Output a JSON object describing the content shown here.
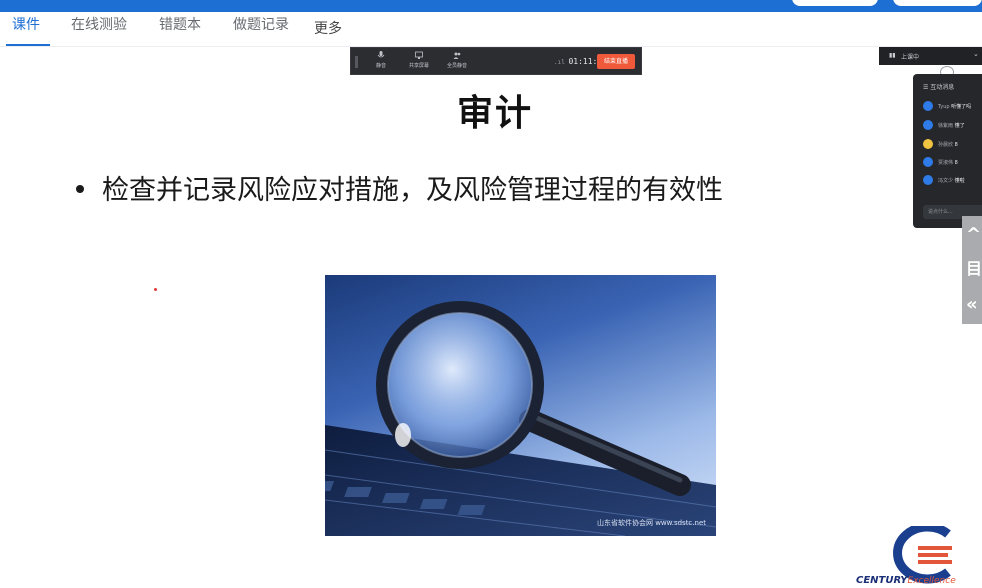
{
  "tabs": [
    {
      "label": "课件",
      "active": true
    },
    {
      "label": "在线测验",
      "active": false
    },
    {
      "label": "错题本",
      "active": false
    },
    {
      "label": "做题记录",
      "active": false
    },
    {
      "label": "更多",
      "active": false
    }
  ],
  "meeting_bar": {
    "mute_label": "静音",
    "share_label": "共享屏幕",
    "members_label": "全员静音",
    "timer": "01:11:32",
    "end_label": "结束直播"
  },
  "slide": {
    "title": "审计",
    "bullet": "检查并记录风险应对措施，及风险管理过程的有效性",
    "image_watermark": "山东省软件协会网 www.sdstc.net"
  },
  "panel": {
    "status": "上课中",
    "header": "互动消息",
    "messages": [
      {
        "name": "Tyup",
        "text": "听懂了吗"
      },
      {
        "name": "徐紫雨",
        "text": "懂了"
      },
      {
        "name": "孙晨欣",
        "text": "8"
      },
      {
        "name": "贾淑伟",
        "text": "8"
      },
      {
        "name": "冯文少",
        "text": "懂啦"
      }
    ],
    "input_placeholder": "说点什么..."
  },
  "logo": {
    "brand": "CENTURY",
    "tagline": "Excellence"
  },
  "colors": {
    "accent": "#1e6fd3",
    "end_button": "#f05a3a"
  }
}
